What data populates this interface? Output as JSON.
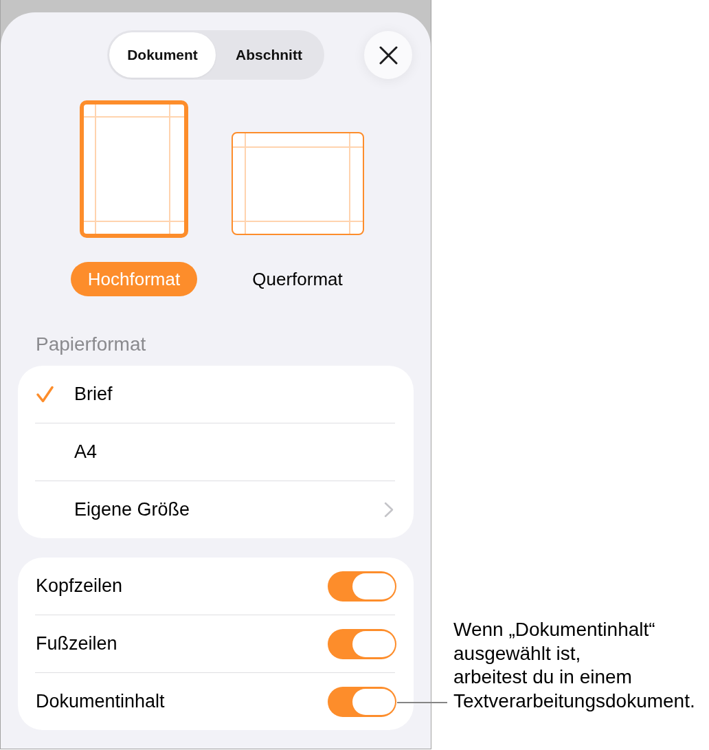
{
  "sheet": {
    "tabs": [
      {
        "label": "Dokument",
        "selected": true
      },
      {
        "label": "Abschnitt",
        "selected": false
      }
    ],
    "orientations": [
      {
        "kind": "portrait",
        "label": "Hochformat",
        "selected": true
      },
      {
        "kind": "landscape",
        "label": "Querformat",
        "selected": false
      }
    ],
    "paper_size": {
      "heading": "Papierformat",
      "options": [
        {
          "kind": "option",
          "label": "Brief",
          "selected": true
        },
        {
          "kind": "option",
          "label": "A4",
          "selected": false
        },
        {
          "kind": "submenu",
          "label": "Eigene Größe",
          "selected": false
        }
      ]
    },
    "toggles": [
      {
        "label": "Kopfzeilen",
        "on": true
      },
      {
        "label": "Fußzeilen",
        "on": true
      },
      {
        "label": "Dokumentinhalt",
        "on": true
      }
    ]
  },
  "callout": {
    "lines": [
      "Wenn „Dokumentinhalt“",
      "ausgewählt ist,",
      "arbeitest du in einem",
      "Textverarbeitungsdokument."
    ]
  }
}
